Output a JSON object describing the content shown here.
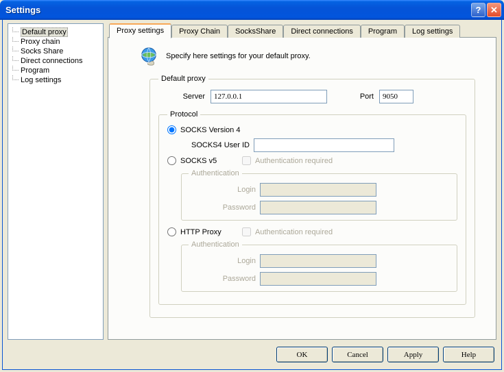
{
  "window": {
    "title": "Settings"
  },
  "tree": {
    "items": [
      {
        "label": "Default proxy",
        "selected": true
      },
      {
        "label": "Proxy chain"
      },
      {
        "label": "Socks Share"
      },
      {
        "label": "Direct connections"
      },
      {
        "label": "Program"
      },
      {
        "label": "Log settings"
      }
    ]
  },
  "tabs": {
    "items": [
      {
        "label": "Proxy settings",
        "active": true
      },
      {
        "label": "Proxy Chain"
      },
      {
        "label": "SocksShare"
      },
      {
        "label": "Direct connections"
      },
      {
        "label": "Program"
      },
      {
        "label": "Log settings"
      }
    ]
  },
  "intro": "Specify here settings for your default proxy.",
  "default_proxy": {
    "legend": "Default proxy",
    "server_label": "Server",
    "server_value": "127.0.0.1",
    "port_label": "Port",
    "port_value": "9050"
  },
  "protocol": {
    "legend": "Protocol",
    "socks4": {
      "label": "SOCKS Version 4",
      "userid_label": "SOCKS4 User ID",
      "userid_value": ""
    },
    "socks5": {
      "label": "SOCKS v5",
      "auth_required": "Authentication required",
      "auth_legend": "Authentication",
      "login_label": "Login",
      "login_value": "",
      "password_label": "Password",
      "password_value": ""
    },
    "http": {
      "label": "HTTP Proxy",
      "auth_required": "Authentication required",
      "auth_legend": "Authentication",
      "login_label": "Login",
      "login_value": "",
      "password_label": "Password",
      "password_value": ""
    }
  },
  "buttons": {
    "ok": "OK",
    "cancel": "Cancel",
    "apply": "Apply",
    "help": "Help"
  }
}
